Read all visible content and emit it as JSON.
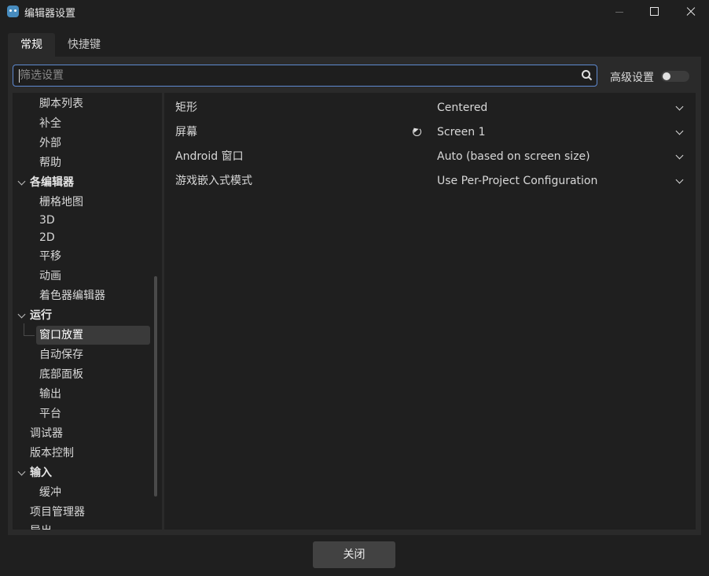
{
  "window": {
    "title": "编辑器设置",
    "icon": "godot-icon"
  },
  "tabs": [
    {
      "label": "常规",
      "active": true
    },
    {
      "label": "快捷键",
      "active": false
    }
  ],
  "search": {
    "value": "",
    "placeholder": "筛选设置"
  },
  "advanced": {
    "label": "高级设置",
    "enabled": false
  },
  "tree": {
    "items": [
      {
        "label": "脚本列表",
        "level": "child"
      },
      {
        "label": "补全",
        "level": "child"
      },
      {
        "label": "外部",
        "level": "child"
      },
      {
        "label": "帮助",
        "level": "child"
      },
      {
        "label": "各编辑器",
        "level": "category"
      },
      {
        "label": "栅格地图",
        "level": "child"
      },
      {
        "label": "3D",
        "level": "child"
      },
      {
        "label": "2D",
        "level": "child"
      },
      {
        "label": "平移",
        "level": "child"
      },
      {
        "label": "动画",
        "level": "child"
      },
      {
        "label": "着色器编辑器",
        "level": "child"
      },
      {
        "label": "运行",
        "level": "category"
      },
      {
        "label": "窗口放置",
        "level": "child",
        "selected": true
      },
      {
        "label": "自动保存",
        "level": "child"
      },
      {
        "label": "底部面板",
        "level": "child"
      },
      {
        "label": "输出",
        "level": "child"
      },
      {
        "label": "平台",
        "level": "child"
      },
      {
        "label": "调试器",
        "level": "top"
      },
      {
        "label": "版本控制",
        "level": "top"
      },
      {
        "label": "输入",
        "level": "category"
      },
      {
        "label": "缓冲",
        "level": "child"
      },
      {
        "label": "项目管理器",
        "level": "top"
      },
      {
        "label": "导出",
        "level": "top"
      }
    ]
  },
  "settings": {
    "rows": [
      {
        "label": "矩形",
        "value": "Centered",
        "modified": false
      },
      {
        "label": "屏幕",
        "value": "Screen 1",
        "modified": true
      },
      {
        "label": "Android 窗口",
        "value": "Auto (based on screen size)",
        "modified": false
      },
      {
        "label": "游戏嵌入式模式",
        "value": "Use Per-Project Configuration",
        "modified": false
      }
    ]
  },
  "footer": {
    "close_label": "关闭"
  },
  "colors": {
    "background": "#1f1f1f",
    "panel": "#2a2a2a",
    "accent": "#5f8ad0",
    "selection": "#3a3a3a",
    "button": "#424242"
  }
}
